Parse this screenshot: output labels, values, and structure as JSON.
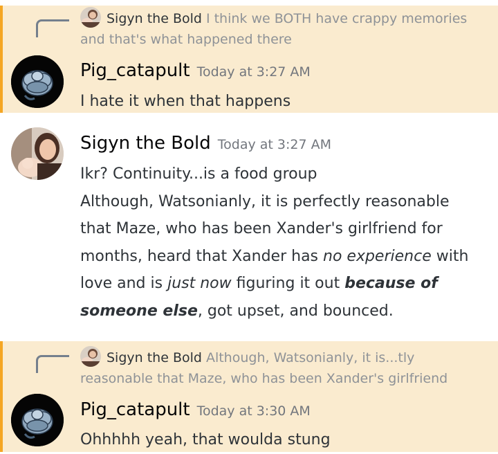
{
  "messages": [
    {
      "reply": {
        "author": "Sigyn the Bold",
        "text": "I think we BOTH have crappy memories and that's what happened there"
      },
      "author": "Pig_catapult",
      "timestamp": "Today at 3:27 AM",
      "lines": [
        "I hate it when that happens"
      ],
      "colors": {
        "author": "#060607",
        "highlight_bg": "#faebcf",
        "highlight_bar": "#f5a623"
      }
    },
    {
      "author": "Sigyn the Bold",
      "timestamp": "Today at 3:27 AM",
      "line1": "Ikr? Continuity...is a food group",
      "segments": [
        "Although, Watsonianly, it is perfectly reasonable that Maze, who has been Xander's girlfriend for months, heard that Xander has ",
        "no experience",
        " with love and is ",
        "just now",
        " figuring it out ",
        "because of someone else",
        ", got upset, and bounced."
      ]
    },
    {
      "reply": {
        "author": "Sigyn the Bold",
        "text": "Although, Watsonianly, it is...tly reasonable that Maze, who has been Xander's girlfriend"
      },
      "author": "Pig_catapult",
      "timestamp": "Today at 3:30 AM",
      "lines": [
        "Ohhhhh yeah, that woulda stung"
      ]
    }
  ]
}
